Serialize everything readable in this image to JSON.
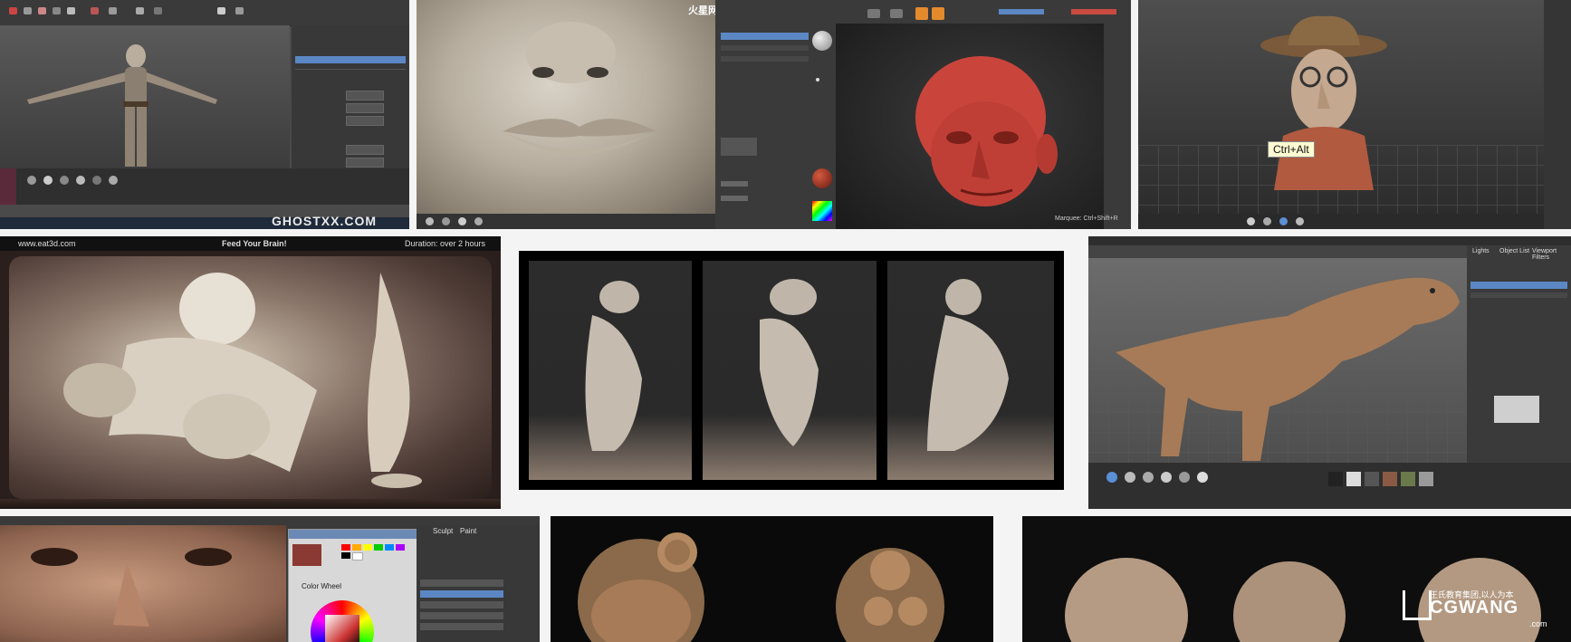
{
  "tiles": {
    "t1": {
      "watermark": "GHOSTXX.COM"
    },
    "t2": {
      "logo_text": "火星网"
    },
    "t3": {
      "status": "Marquee: Ctrl+Shift+R"
    },
    "t4": {
      "tooltip": "Ctrl+Alt"
    },
    "t5": {
      "url": "www.eat3d.com",
      "tagline": "Feed Your Brain!",
      "duration": "Duration: over 2 hours"
    },
    "t6": {},
    "t7": {
      "panel_label_a": "Lights",
      "panel_label_b": "Object List",
      "panel_label_c": "Viewport Filters"
    },
    "t8": {
      "tab_a": "Sculpt",
      "tab_b": "Paint",
      "color_label": "Color Wheel"
    },
    "t9": {},
    "t10": {
      "brand_cn": "王氏教育集团,以人为本",
      "brand_en": "CGWANG",
      "brand_domain": ".com"
    }
  },
  "colors": {
    "ui_dark": "#3a3a3a",
    "clay": "#c7b9a5",
    "red_clay": "#c94a40",
    "bronze": "#a77b57",
    "accent_orange": "#e38a2d",
    "accent_blue": "#5b8fd6"
  }
}
